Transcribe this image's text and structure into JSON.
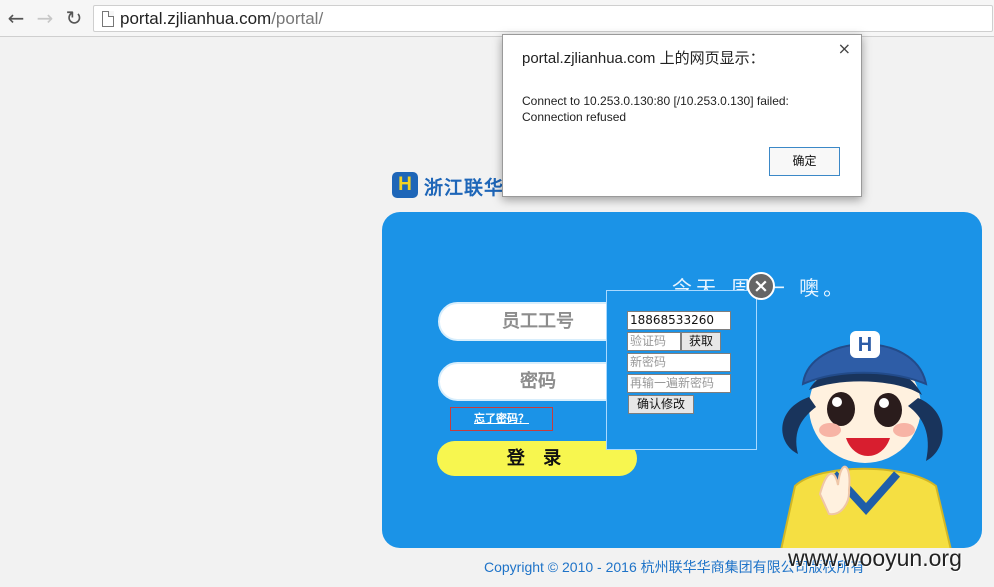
{
  "browser": {
    "url_host": "portal.zjlianhua.com",
    "url_path": "/portal/",
    "back_icon": "back-arrow-icon",
    "forward_icon": "forward-arrow-icon",
    "reload_icon": "reload-icon",
    "page_icon": "page-icon"
  },
  "brand": {
    "logo_letter": "H",
    "name": "浙江联华"
  },
  "login": {
    "username_placeholder": "员工工号",
    "password_placeholder": "密码",
    "forgot_password": "忘了密码？",
    "submit": "登 录",
    "slogan": "今天 周 一 噢。"
  },
  "modify_password_popup": {
    "close_symbol": "×",
    "phone_value": "18868533260",
    "code_placeholder": "验证码",
    "get_code_label": "获取",
    "new_password_placeholder": "新密码",
    "repeat_password_placeholder": "再输一遍新密码",
    "confirm_label": "确认修改"
  },
  "footer": {
    "copyright": "Copyright © 2010 - 2016 杭州联华华商集团有限公司版权所有",
    "watermark": "www.wooyun.org"
  },
  "alert": {
    "title": "portal.zjlianhua.com 上的网页显示：",
    "message_line_1": "Connect to 10.253.0.130:80 [/10.253.0.130] failed:",
    "message_line_2": "Connection refused",
    "ok_label": "确定",
    "close_symbol": "×"
  },
  "colors": {
    "panel_blue": "#1b93e7",
    "button_yellow": "#f7f64f",
    "brand_blue": "#1e66b8",
    "copyright_blue": "#1e73c8"
  }
}
